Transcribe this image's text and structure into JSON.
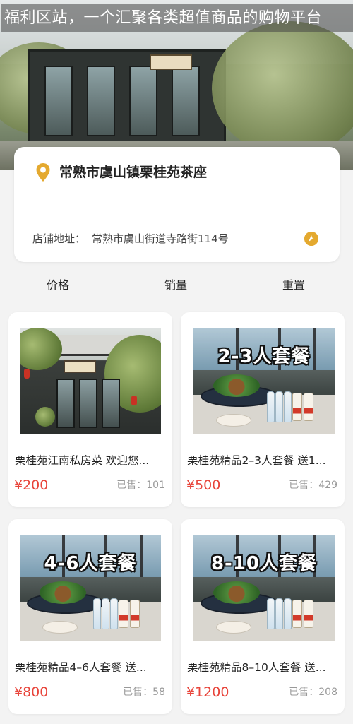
{
  "overlay_title": "福利区站，一个汇聚各类超值商品的购物平台",
  "hero": {
    "sign_text": "苑桂栗"
  },
  "store": {
    "name": "常熟市虞山镇栗桂苑茶座",
    "address_label": "店铺地址：",
    "address_value": "常熟市虞山街道寺路街114号",
    "location_icon": "location-pin-icon",
    "navigate_icon": "navigation-icon"
  },
  "sort_bar": {
    "price_label": "价格",
    "sales_label": "销量",
    "reset_label": "重置"
  },
  "products": [
    {
      "title": "栗桂苑江南私房菜  欢迎您...",
      "price": "¥200",
      "sold": "已售：101",
      "image_caption": ""
    },
    {
      "title": "栗桂苑精品2–3人套餐  送1...",
      "price": "¥500",
      "sold": "已售：429",
      "image_caption": "2-3人套餐"
    },
    {
      "title": "栗桂苑精品4–6人套餐  送...",
      "price": "¥800",
      "sold": "已售：58",
      "image_caption": "4-6人套餐"
    },
    {
      "title": "栗桂苑精品8–10人套餐  送...",
      "price": "¥1200",
      "sold": "已售：208",
      "image_caption": "8-10人套餐"
    }
  ],
  "colors": {
    "price": "#e8443a",
    "accent": "#e4a92f",
    "background": "#f3f3f3"
  }
}
